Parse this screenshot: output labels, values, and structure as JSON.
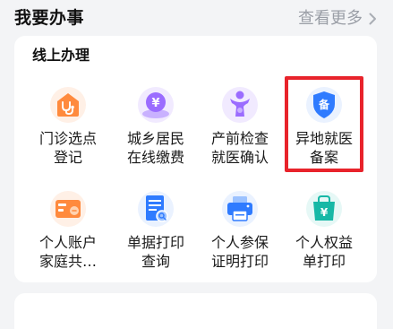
{
  "section": {
    "title": "我要办事",
    "more_label": "查看更多"
  },
  "card": {
    "title": "线上办理",
    "services": [
      {
        "label": "门诊选点\n登记",
        "icon": "clinic-registration-icon"
      },
      {
        "label": "城乡居民\n在线缴费",
        "icon": "resident-payment-icon"
      },
      {
        "label": "产前检查\n就医确认",
        "icon": "prenatal-checkup-icon"
      },
      {
        "label": "异地就医\n备案",
        "icon": "remote-medical-filing-icon"
      },
      {
        "label": "个人账户\n家庭共…",
        "icon": "family-account-icon"
      },
      {
        "label": "单据打印\n查询",
        "icon": "receipt-print-query-icon"
      },
      {
        "label": "个人参保\n证明打印",
        "icon": "insurance-proof-print-icon"
      },
      {
        "label": "个人权益\n单打印",
        "icon": "personal-rights-print-icon"
      }
    ]
  },
  "colors": {
    "accent_orange": "#ff8a3d",
    "accent_purple": "#9b6cff",
    "accent_blue": "#2f7bff",
    "highlight_red": "#e8232b"
  }
}
